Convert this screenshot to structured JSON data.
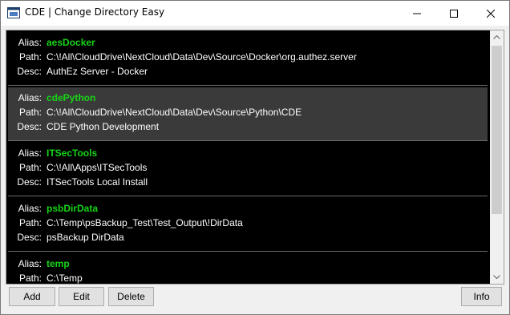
{
  "window": {
    "title": "CDE | Change Directory Easy"
  },
  "labels": {
    "alias": "Alias:",
    "path": "Path:",
    "desc": "Desc:"
  },
  "entries": [
    {
      "alias": "aesDocker",
      "path": "C:\\!All\\CloudDrive\\NextCloud\\Data\\Dev\\Source\\Docker\\org.authez.server",
      "desc": "AuthEz Server - Docker"
    },
    {
      "alias": "cdePython",
      "path": "C:\\!All\\CloudDrive\\NextCloud\\Data\\Dev\\Source\\Python\\CDE",
      "desc": "CDE Python Development"
    },
    {
      "alias": "ITSecTools",
      "path": "C:\\!All\\Apps\\ITSecTools",
      "desc": "ITSecTools Local Install"
    },
    {
      "alias": "psbDirData",
      "path": "C:\\Temp\\psBackup_Test\\Test_Output\\!DirData",
      "desc": "psBackup DirData"
    },
    {
      "alias": "temp",
      "path": "C:\\Temp",
      "desc": ""
    }
  ],
  "selected_alias": "cdePython",
  "buttons": {
    "add": "Add",
    "edit": "Edit",
    "delete": "Delete",
    "info": "Info"
  },
  "colors": {
    "list_background": "#000000",
    "alias_color": "#17d417",
    "selected_row": "#3a3a3a"
  }
}
